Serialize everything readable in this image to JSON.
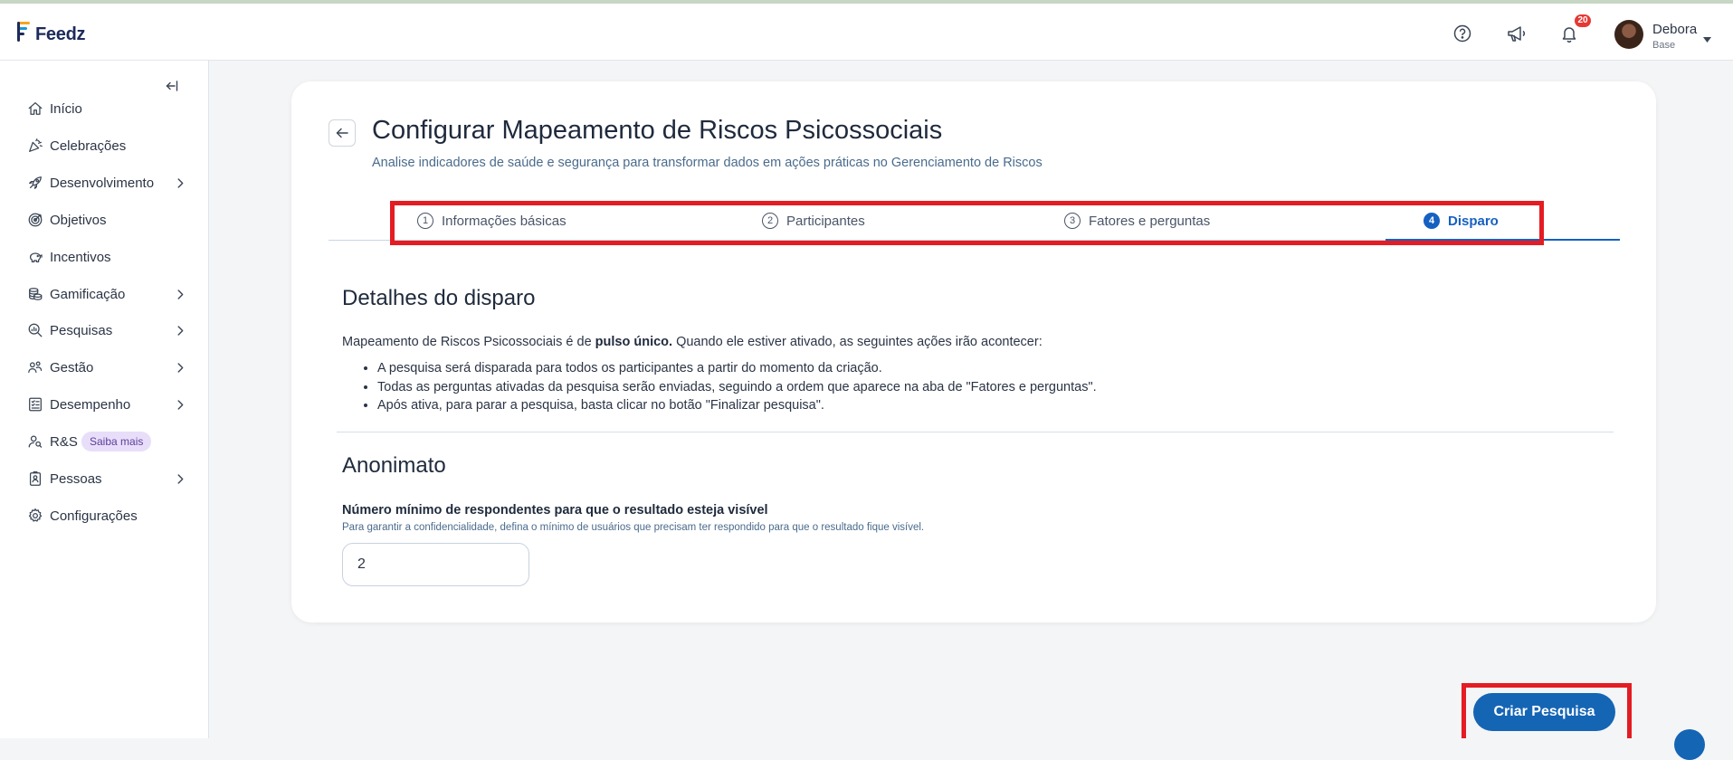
{
  "app": {
    "logo_text": "Feedz"
  },
  "header": {
    "notifications_count": "20",
    "user": {
      "name": "Debora",
      "role": "Base"
    },
    "icons": [
      "help-circle-icon",
      "megaphone-icon",
      "bell-icon"
    ]
  },
  "sidebar": {
    "items": [
      {
        "label": "Início",
        "icon": "home-icon",
        "chevron": false
      },
      {
        "label": "Celebrações",
        "icon": "party-popper-icon",
        "chevron": false
      },
      {
        "label": "Desenvolvimento",
        "icon": "rocket-icon",
        "chevron": true
      },
      {
        "label": "Objetivos",
        "icon": "target-icon",
        "chevron": false
      },
      {
        "label": "Incentivos",
        "icon": "piggy-bank-icon",
        "chevron": false
      },
      {
        "label": "Gamificação",
        "icon": "coins-icon",
        "chevron": true
      },
      {
        "label": "Pesquisas",
        "icon": "search-chart-icon",
        "chevron": true
      },
      {
        "label": "Gestão",
        "icon": "users-icon",
        "chevron": true
      },
      {
        "label": "Desempenho",
        "icon": "checklist-icon",
        "chevron": true
      },
      {
        "label": "R&S",
        "icon": "user-search-icon",
        "chevron": false,
        "pill": "Saiba mais"
      },
      {
        "label": "Pessoas",
        "icon": "id-badge-icon",
        "chevron": true
      },
      {
        "label": "Configurações",
        "icon": "gear-icon",
        "chevron": false
      }
    ]
  },
  "page": {
    "title": "Configurar Mapeamento de Riscos Psicossociais",
    "subtitle": "Analise indicadores de saúde e segurança para transformar dados em ações práticas no Gerenciamento de Riscos"
  },
  "steps": [
    {
      "num": "1",
      "label": "Informações básicas",
      "active": false
    },
    {
      "num": "2",
      "label": "Participantes",
      "active": false
    },
    {
      "num": "3",
      "label": "Fatores e perguntas",
      "active": false
    },
    {
      "num": "4",
      "label": "Disparo",
      "active": true
    }
  ],
  "details": {
    "title": "Detalhes do disparo",
    "intro_prefix": "Mapeamento de Riscos Psicossociais é de ",
    "intro_bold": "pulso único.",
    "intro_suffix": " Quando ele estiver ativado, as seguintes ações irão acontecer:",
    "bullets": [
      "A pesquisa será disparada para todos os participantes a partir do momento da criação.",
      "Todas as perguntas ativadas da pesquisa serão enviadas, seguindo a ordem que aparece na aba de \"Fatores e perguntas\".",
      "Após ativa, para parar a pesquisa, basta clicar no botão \"Finalizar pesquisa\"."
    ]
  },
  "anonymity": {
    "title": "Anonimato",
    "label": "Número mínimo de respondentes para que o resultado esteja visível",
    "help": "Para garantir a confidencialidade, defina o mínimo de usuários que precisam ter respondido para que o resultado fique visível.",
    "value": "2"
  },
  "actions": {
    "create_label": "Criar Pesquisa"
  },
  "colors": {
    "accent": "#1660c2",
    "cta": "#1565b5",
    "highlight": "#e41c23",
    "badge": "#e53935"
  }
}
